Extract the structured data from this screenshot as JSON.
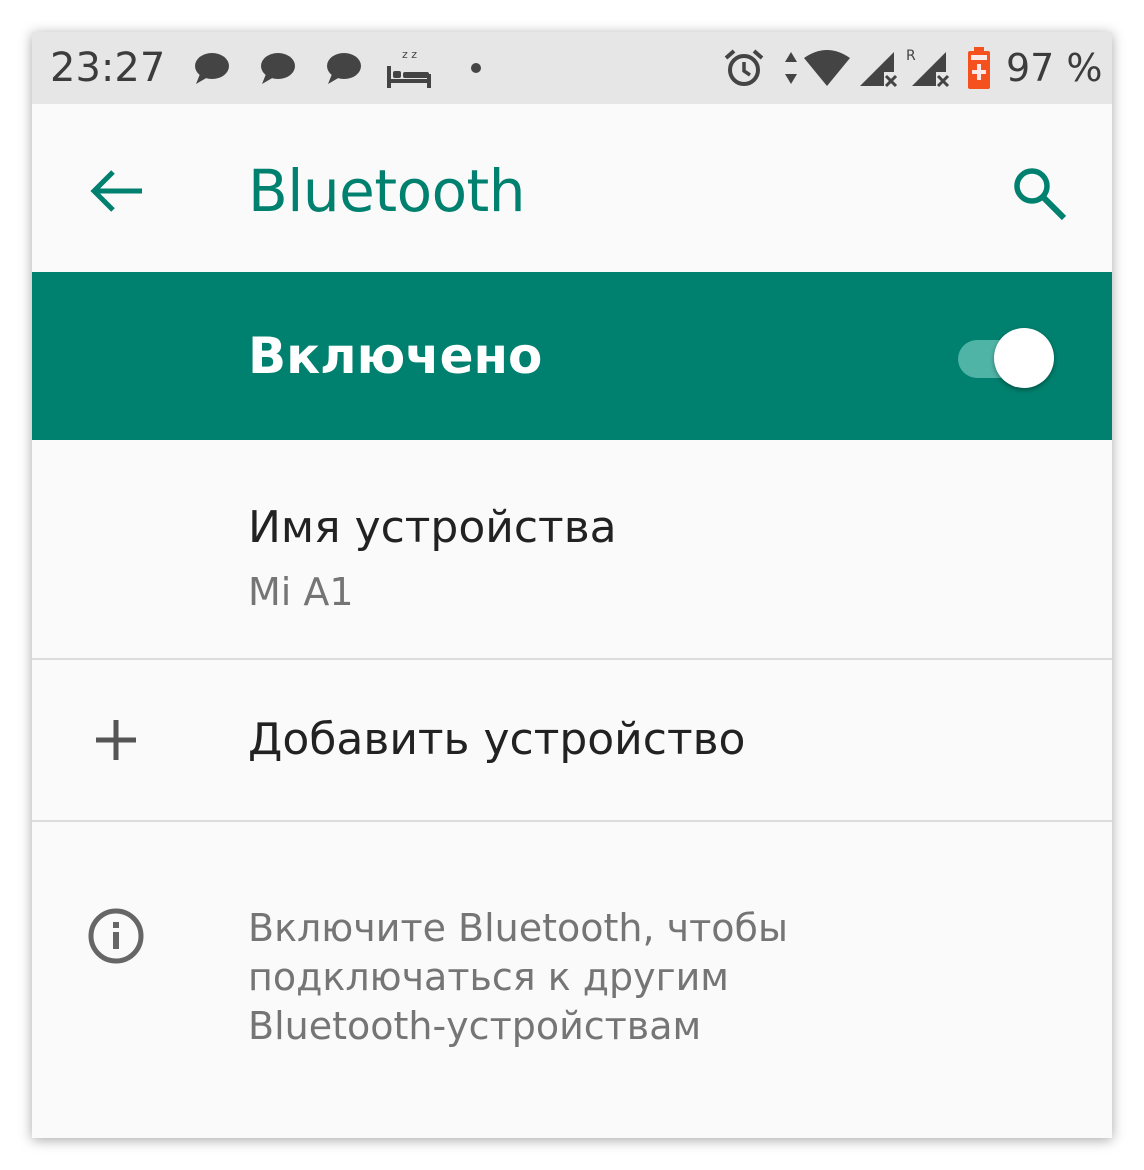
{
  "status_bar": {
    "time": "23:27",
    "notification_icons": [
      "message-icon",
      "message-icon",
      "message-icon",
      "sleep-icon",
      "dot-icon"
    ],
    "system_icons": [
      "alarm-icon",
      "data-arrows-icon",
      "wifi-icon",
      "signal-icon",
      "roaming-signal-icon",
      "battery-icon"
    ],
    "roaming_mark": "R",
    "sleep_mark": "z z",
    "battery_text": "97 %",
    "battery_color": "#f4511e"
  },
  "app_bar": {
    "title": "Bluetooth",
    "back_icon": "arrow-back-icon",
    "search_icon": "search-icon",
    "accent_color": "#00806e"
  },
  "master_switch": {
    "label": "Включено",
    "state": "on",
    "background": "#00806e"
  },
  "preferences": {
    "device_name": {
      "title": "Имя устройства",
      "summary": "Mi A1"
    },
    "add_device": {
      "icon": "plus-icon",
      "title": "Добавить устройство"
    },
    "info": {
      "icon": "info-icon",
      "text": "Включите Bluetooth, чтобы\nподключаться к другим\nBluetooth-устройствам"
    }
  }
}
